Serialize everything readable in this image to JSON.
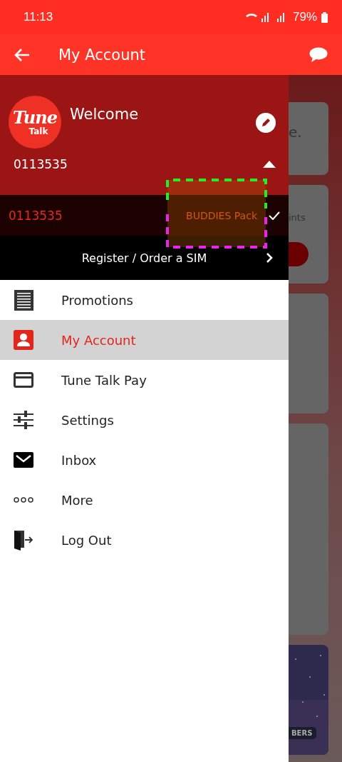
{
  "status_bar": {
    "time": "11:13",
    "battery": "79%"
  },
  "app_bar": {
    "title": "My Account"
  },
  "drawer": {
    "logo": {
      "name": "Tune",
      "sub": "Talk"
    },
    "welcome": "Welcome",
    "phone": "0113535",
    "expanded": true,
    "accounts": [
      {
        "number": "0113535",
        "plan": "BUDDIES Pack",
        "selected": true
      }
    ],
    "register": "Register / Order a SIM",
    "menu": [
      {
        "kind": "promotions",
        "label": "Promotions",
        "selected": false
      },
      {
        "kind": "account",
        "label": "My Account",
        "selected": true
      },
      {
        "kind": "card",
        "label": "Tune Talk Pay",
        "selected": false
      },
      {
        "kind": "settings",
        "label": "Settings",
        "selected": false
      },
      {
        "kind": "inbox",
        "label": "Inbox",
        "selected": false
      },
      {
        "kind": "more",
        "label": "More",
        "selected": false
      },
      {
        "kind": "logout",
        "label": "Log Out",
        "selected": false
      }
    ]
  },
  "background_cards": [
    {
      "kind": "text",
      "text": "e."
    },
    {
      "kind": "button",
      "text": "ints"
    },
    {
      "kind": "blank"
    },
    {
      "kind": "blank"
    },
    {
      "kind": "picture",
      "text": "BERS"
    }
  ]
}
